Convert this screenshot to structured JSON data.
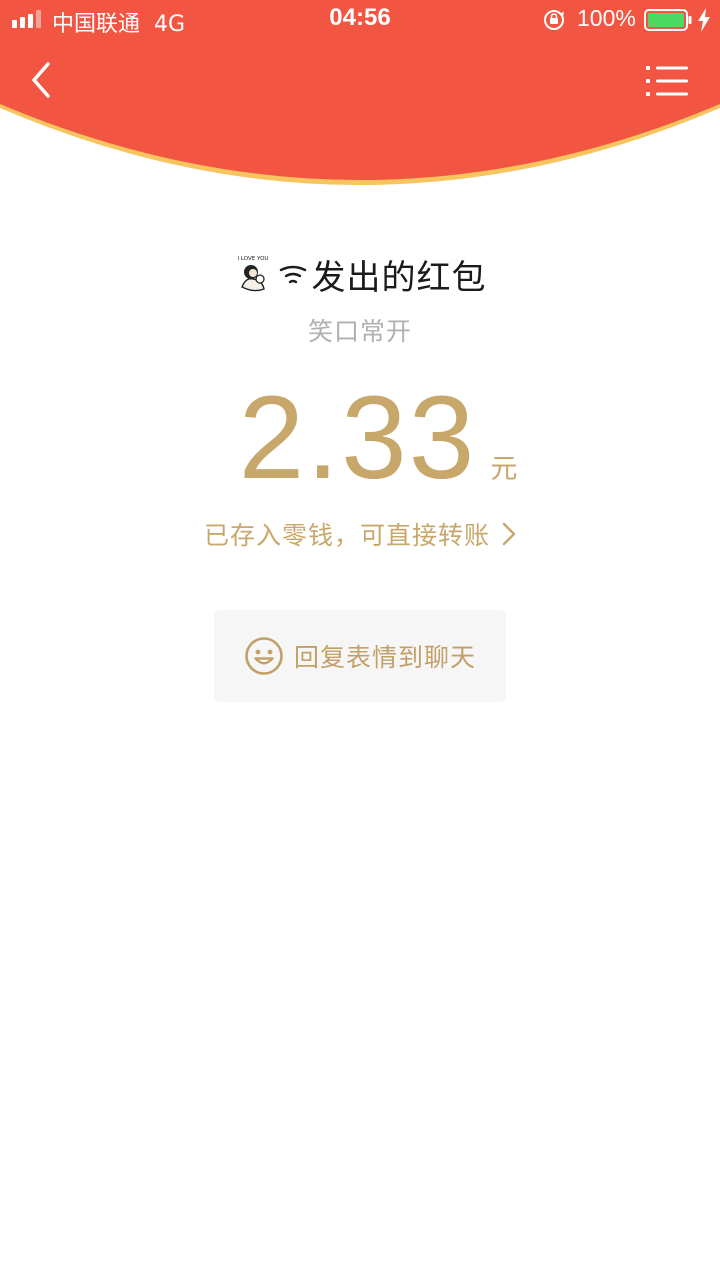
{
  "status_bar": {
    "carrier": "中国联通",
    "network": "4G",
    "time": "04:56",
    "battery_percent": "100%",
    "colors": {
      "text": "#ffffff",
      "battery_fill": "#4cd964"
    }
  },
  "header": {
    "background_color": "#f25542",
    "rim_color": "#f7c45d",
    "back_icon": "chevron-left-icon",
    "menu_icon": "list-icon"
  },
  "packet": {
    "sender_label": "发出的红包",
    "avatar_caption": "I LOVE YOU",
    "greeting": "笑口常开",
    "amount": "2.33",
    "unit": "元",
    "wallet_note": "已存入零钱，可直接转账",
    "accent_color": "#c8a76b"
  },
  "actions": {
    "reply_label": "回复表情到聊天",
    "reply_icon": "smile-icon"
  }
}
